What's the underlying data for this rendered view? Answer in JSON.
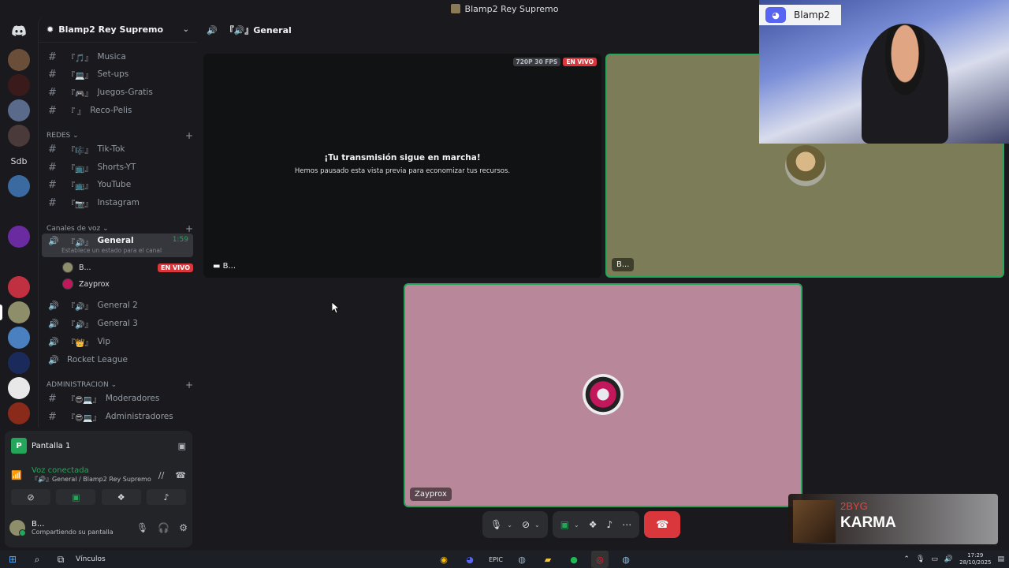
{
  "window": {
    "title": "Blamp2 Rey Supremo"
  },
  "server": {
    "name": "Blamp2 Rey Supremo"
  },
  "rail": {
    "sdb_label": "Sdb"
  },
  "channels": {
    "top": [
      {
        "name": "Musica",
        "emoji": "『🎵』"
      },
      {
        "name": "Set-ups",
        "emoji": "『💻』"
      },
      {
        "name": "Juegos-Gratis",
        "emoji": "『🎮』"
      },
      {
        "name": "Reco-Pelis",
        "emoji": ""
      }
    ],
    "redes_label": "REDES",
    "redes": [
      {
        "name": "Tik-Tok",
        "emoji": "『🎼』"
      },
      {
        "name": "Shorts-YT",
        "emoji": "『📺』"
      },
      {
        "name": "YouTube",
        "emoji": "『📺』"
      },
      {
        "name": "Instagram",
        "emoji": "『📷』"
      }
    ],
    "voice_label": "Canales de voz",
    "general": {
      "name": "General",
      "emoji": "『🔊』",
      "time": "1:59",
      "status": "Establece un estado para el canal"
    },
    "voice_users": [
      {
        "name": "B...",
        "badge": "EN VIVO"
      },
      {
        "name": "Zayprox",
        "badge": ""
      }
    ],
    "voice_more": [
      {
        "name": "General 2",
        "emoji": "『🔊』"
      },
      {
        "name": "General 3",
        "emoji": "『🔊』"
      },
      {
        "name": "Vip",
        "emoji": "『👑』"
      },
      {
        "name": "Rocket League",
        "emoji": ""
      }
    ],
    "admin_label": "ADMINISTRACION",
    "admin": [
      {
        "name": "Moderadores",
        "emoji": "『😎💻』"
      },
      {
        "name": "Administradores",
        "emoji": "『😎💻』"
      }
    ]
  },
  "panel": {
    "screen_label": "Pantalla 1",
    "voice_status": "Voz conectada",
    "voice_channel": "『🔊』General / Blamp2 Rey Supremo",
    "user_name": "B...",
    "user_status": "Compartiendo su pantalla"
  },
  "main": {
    "header_channel": "『🔊』General",
    "quality_badge": "720P 30 FPS",
    "live_badge": "EN VIVO",
    "paused_title": "¡Tu transmisión sigue en marcha!",
    "paused_sub": "Hemos pausado esta vista previa para economizar tus recursos.",
    "tile1_name": "B...",
    "tile2_name": "B...",
    "tile3_name": "Zayprox"
  },
  "overlay": {
    "cam_name": "Blamp2",
    "music_artist": "2BYG",
    "music_song": "KARMA"
  },
  "taskbar": {
    "links_label": "Vínculos",
    "time": "17:29",
    "date": "28/10/2025"
  }
}
